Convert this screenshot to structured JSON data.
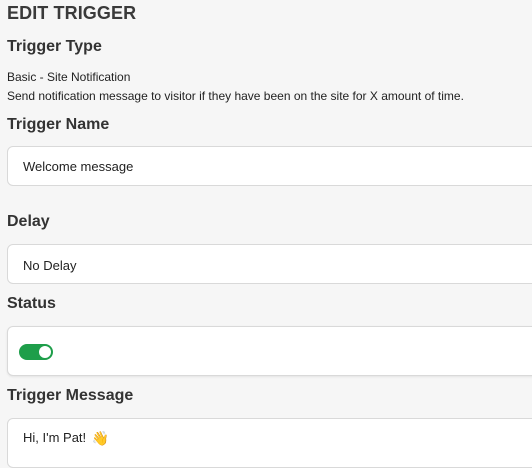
{
  "page": {
    "title": "EDIT TRIGGER"
  },
  "trigger_type": {
    "label": "Trigger Type",
    "name": "Basic - Site Notification",
    "description": "Send notification message to visitor if they have been on the site for X amount of time."
  },
  "trigger_name": {
    "label": "Trigger Name",
    "value": "Welcome message"
  },
  "delay": {
    "label": "Delay",
    "selected": "No Delay"
  },
  "status": {
    "label": "Status",
    "enabled": true,
    "color_on": "#1e9e4a"
  },
  "trigger_message": {
    "label": "Trigger Message",
    "text": "Hi, I'm Pat!",
    "emoji": "👋",
    "emoji_name": "waving-hand-icon"
  }
}
